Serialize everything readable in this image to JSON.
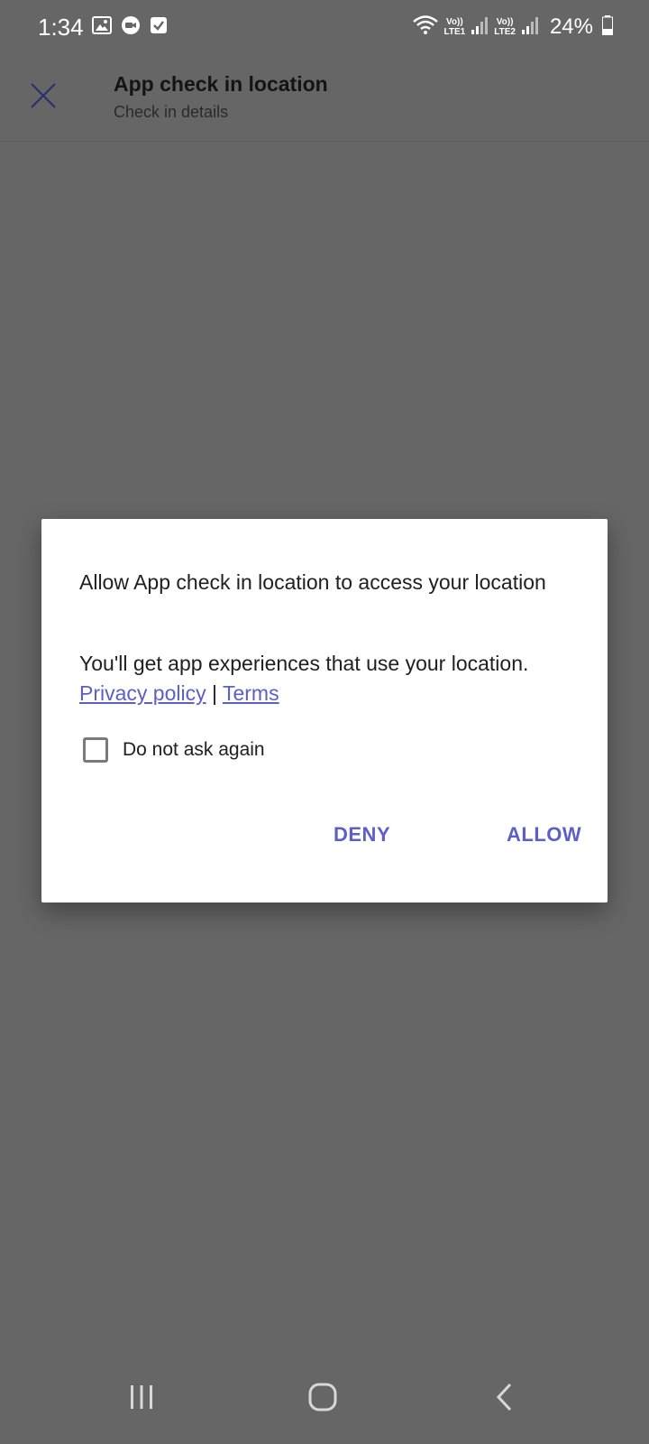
{
  "status_bar": {
    "time": "1:34",
    "sim1_top": "Vo))",
    "sim1_bottom": "LTE1",
    "sim2_top": "Vo))",
    "sim2_bottom": "LTE2",
    "battery": "24%",
    "icons": [
      "gallery-icon",
      "video-call-icon",
      "checkbox-notification-icon",
      "wifi-icon",
      "signal-icon",
      "battery-icon"
    ]
  },
  "app_bar": {
    "title": "App check in location",
    "subtitle": "Check in details",
    "close_icon": "close-icon"
  },
  "dialog": {
    "title": "Allow App check in location to access your location",
    "body": "You'll get app experiences that use your location.",
    "privacy_link": "Privacy policy",
    "separator": "|",
    "terms_link": "Terms",
    "checkbox_label": "Do not ask again",
    "checkbox_checked": false,
    "deny_label": "DENY",
    "allow_label": "ALLOW"
  },
  "nav_bar": {
    "icons": [
      "recents-icon",
      "home-icon",
      "back-icon"
    ]
  },
  "colors": {
    "scrim": "#666666",
    "accent": "#5b5fc7",
    "dialog_bg": "#ffffff",
    "text": "#202020"
  }
}
